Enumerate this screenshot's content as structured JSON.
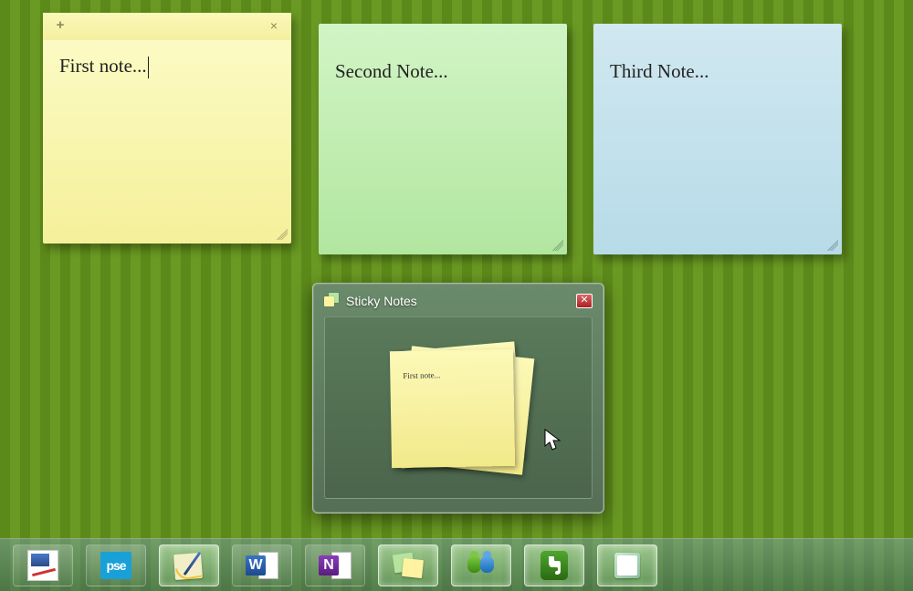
{
  "notes": [
    {
      "text": "First note...",
      "color": "yellow",
      "active": true
    },
    {
      "text": "Second Note...",
      "color": "green",
      "active": false
    },
    {
      "text": "Third Note...",
      "color": "blue",
      "active": false
    }
  ],
  "note_controls": {
    "new_tip": "+",
    "close_tip": "×"
  },
  "peek": {
    "title": "Sticky Notes",
    "thumb_text": "First note...",
    "close_label": "✕"
  },
  "taskbar": {
    "items": [
      {
        "name": "paint-net",
        "label": "Paint.NET"
      },
      {
        "name": "photoshop-elements",
        "label": "pse"
      },
      {
        "name": "windows-journal",
        "label": "Windows Journal"
      },
      {
        "name": "word",
        "label": "W"
      },
      {
        "name": "onenote",
        "label": "N"
      },
      {
        "name": "sticky-notes",
        "label": "Sticky Notes"
      },
      {
        "name": "messenger",
        "label": "Windows Live Messenger"
      },
      {
        "name": "evernote",
        "label": "Evernote"
      },
      {
        "name": "notebook",
        "label": "Notebook"
      }
    ]
  }
}
